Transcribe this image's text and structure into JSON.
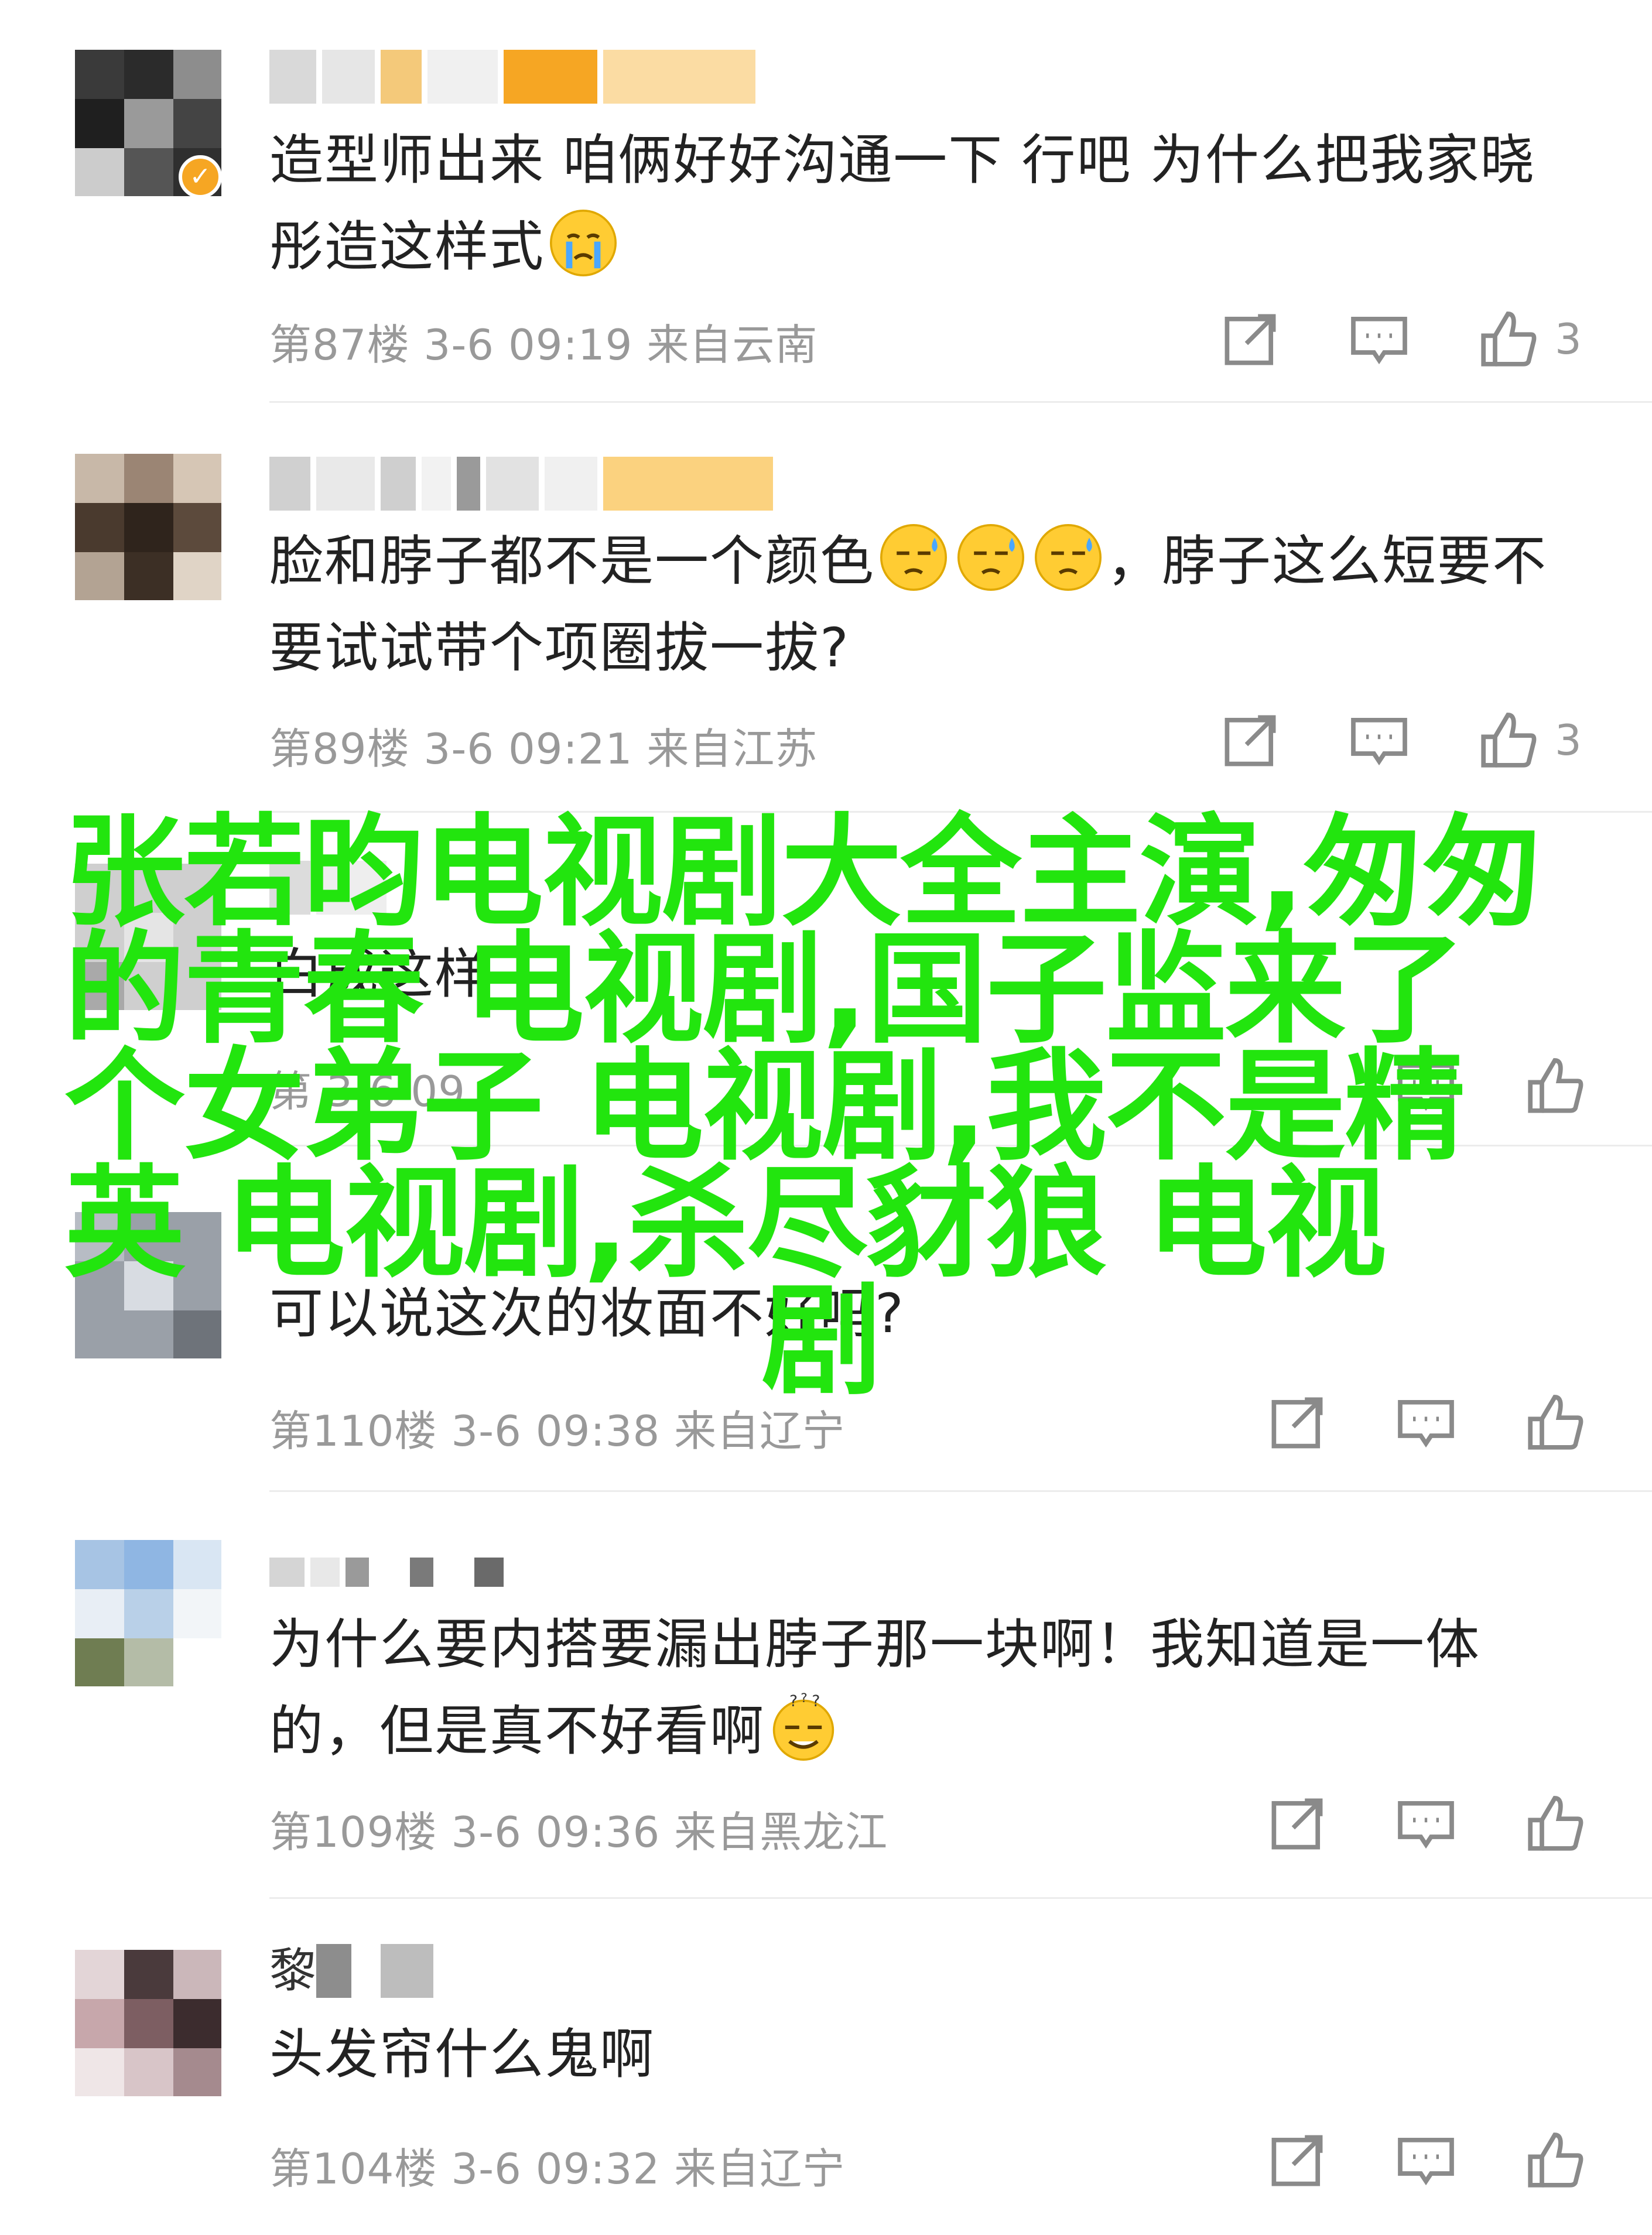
{
  "comments": [
    {
      "text": "造型师出来 咱俩好好沟通一下 行吧 为什么把我家晓彤造这样式",
      "meta": "第87楼 3-6 09:19 来自云南",
      "likes": "3"
    },
    {
      "text": "脸和脖子都不是一个颜色",
      "text_tail": "，脖子这么短要不要试试带个项圈拔一拔?",
      "meta": "第89楼 3-6 09:21 来自江苏",
      "likes": "3"
    },
    {
      "text": "白成这样",
      "meta": "第 3-6 09",
      "likes": ""
    },
    {
      "text": "可以说这次的妆面不好吗?",
      "meta": "第110楼 3-6 09:38 来自辽宁",
      "likes": ""
    },
    {
      "text": "为什么要内搭要漏出脖子那一块啊！我知道是一体的，但是真不好看啊",
      "meta": "第109楼 3-6 09:36 来自黑龙江",
      "likes": ""
    },
    {
      "name_char": "黎",
      "text": "头发帘什么鬼啊",
      "meta": "第104楼 3-6 09:32 来自辽宁",
      "likes": ""
    }
  ],
  "overlay": {
    "title": "张若昀电视剧大全主演,匆匆的青春 电视剧,国子监来了个女弟子 电视剧,我不是精英 电视剧,杀尽豺狼 电视",
    "title_tail": "剧"
  },
  "icons": {
    "forward": "forward-icon",
    "comment": "comment-icon",
    "like": "thumb-up-icon",
    "emoji_cry": "crying-emoji-icon",
    "emoji_sweat": "sweat-emoji-icon",
    "emoji_dizzy": "dizzy-emoji-icon",
    "verified": "verified-badge-icon"
  },
  "colors": {
    "overlay_text": "#22e50e",
    "meta_text": "#999999",
    "body_text": "#222222",
    "verified_badge": "#f6a623"
  }
}
